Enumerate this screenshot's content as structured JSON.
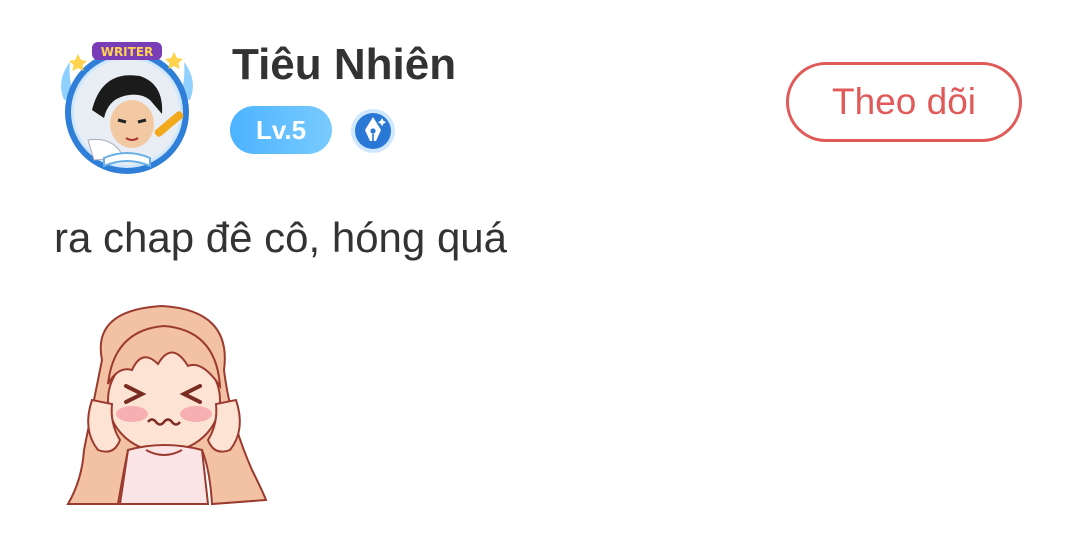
{
  "user": {
    "name": "Tiêu Nhiên",
    "level": "Lv.5",
    "frame_label": "WRITER",
    "avatar_icon": "writer-avatar-icon",
    "writer_badge_icon": "fountain-pen-icon"
  },
  "follow_button": {
    "label": "Theo dõi"
  },
  "comment": {
    "text": "ra chap đê cô, hóng quá",
    "sticker": "embarrassed-girl-sticker"
  },
  "colors": {
    "accent_red": "#e05a5a",
    "level_blue": "#4cb3ff",
    "text_dark": "#333333"
  }
}
